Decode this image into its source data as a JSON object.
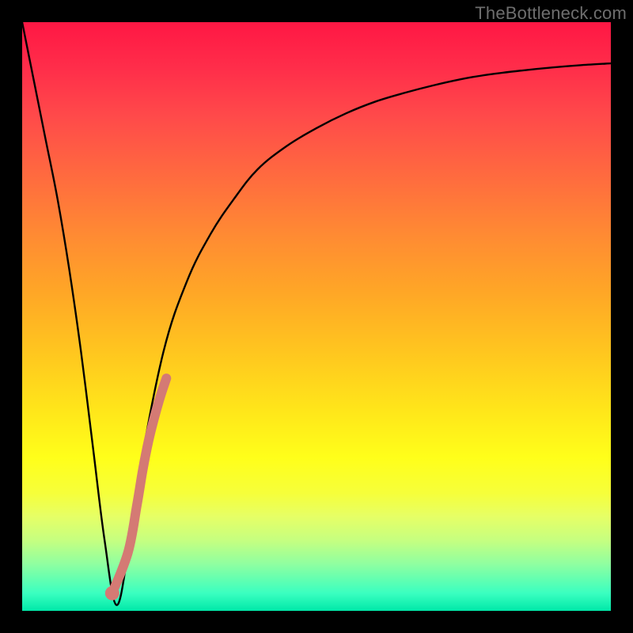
{
  "watermark": "TheBottleneck.com",
  "chart_data": {
    "type": "line",
    "title": "",
    "xlabel": "",
    "ylabel": "",
    "xlim": [
      0,
      100
    ],
    "ylim": [
      0,
      100
    ],
    "grid": false,
    "legend": {
      "visible": false
    },
    "series": [
      {
        "name": "bottleneck-curve",
        "color": "#000000",
        "x": [
          0,
          2,
          4,
          6,
          8,
          10,
          12,
          14,
          16,
          18,
          20,
          24,
          28,
          32,
          36,
          40,
          45,
          50,
          55,
          60,
          65,
          70,
          75,
          80,
          85,
          90,
          95,
          100
        ],
        "values": [
          100,
          90,
          80,
          70,
          58,
          44,
          28,
          12,
          1,
          10,
          24,
          44,
          56,
          64,
          70,
          75,
          79,
          82,
          84.5,
          86.5,
          88,
          89.3,
          90.4,
          91.2,
          91.8,
          92.3,
          92.7,
          93
        ]
      },
      {
        "name": "highlight-segment",
        "color": "#d47a74",
        "x": [
          15.3,
          18,
          19.5,
          20.5,
          21.5,
          22.5,
          23.5,
          24.5
        ],
        "values": [
          3,
          10,
          18,
          24,
          29,
          33,
          36.5,
          39.5
        ]
      }
    ],
    "marker": {
      "name": "optimal-point",
      "color": "#d47a74",
      "x": 15.3,
      "y": 3
    },
    "background_gradient": {
      "top_color": "#ff1744",
      "bottom_color": "#00e8a8",
      "description": "vertical red-to-orange-to-yellow-to-green"
    }
  }
}
